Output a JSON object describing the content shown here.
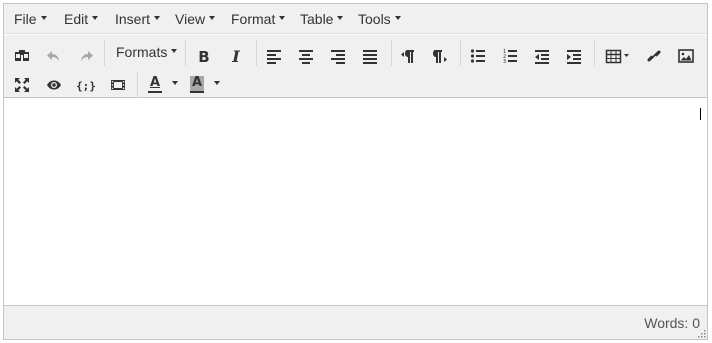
{
  "menubar": {
    "items": [
      {
        "label": "File"
      },
      {
        "label": "Edit"
      },
      {
        "label": "Insert"
      },
      {
        "label": "View"
      },
      {
        "label": "Format"
      },
      {
        "label": "Table"
      },
      {
        "label": "Tools"
      }
    ]
  },
  "toolbar": {
    "formats_label": "Formats",
    "row1_icons": [
      "find-replace-icon",
      "undo-icon",
      "redo-icon",
      "bold-icon",
      "italic-icon",
      "align-left-icon",
      "align-center-icon",
      "align-right-icon",
      "align-justify-icon",
      "ltr-icon",
      "rtl-icon",
      "bullet-list-icon",
      "numbered-list-icon",
      "outdent-icon",
      "indent-icon",
      "table-icon",
      "link-icon",
      "image-icon"
    ],
    "row2_icons": [
      "fullscreen-icon",
      "preview-icon",
      "code-icon",
      "media-icon",
      "text-color-icon",
      "background-color-icon"
    ],
    "text_color_letter": "A",
    "bg_color_letter": "A",
    "undo_redo_disabled": true
  },
  "content": {
    "text": ""
  },
  "statusbar": {
    "words": "Words: 0"
  },
  "colors": {
    "menubar_bg": "#f0f0f0",
    "border": "#c5c5c5",
    "icon": "#333333",
    "disabled_icon": "#a8a8a8"
  }
}
